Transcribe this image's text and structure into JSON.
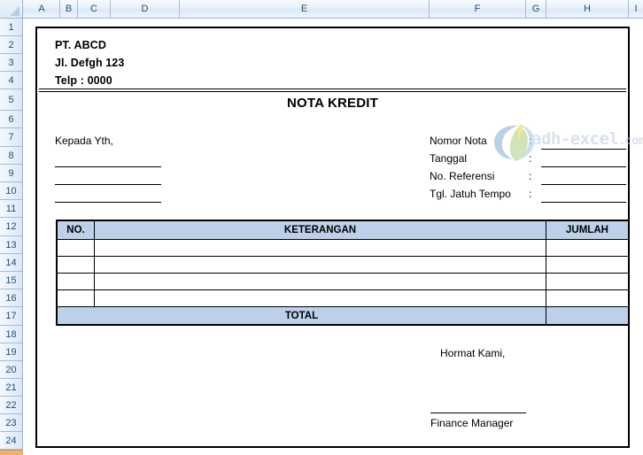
{
  "spreadsheet": {
    "column_headers": [
      "A",
      "B",
      "C",
      "D",
      "E",
      "F",
      "G",
      "H",
      "I"
    ],
    "row_headers": [
      "1",
      "2",
      "3",
      "4",
      "5",
      "6",
      "7",
      "8",
      "9",
      "10",
      "11",
      "12",
      "13",
      "14",
      "15",
      "16",
      "17",
      "18",
      "19",
      "20",
      "21",
      "22",
      "23",
      "24"
    ],
    "select_all_corner": "select-all-corner"
  },
  "document": {
    "company": {
      "name": "PT. ABCD",
      "address": "Jl. Defgh 123",
      "phone": "Telp : 0000"
    },
    "title": "NOTA KREDIT",
    "recipient": {
      "label": "Kepada Yth,",
      "lines": [
        "",
        "",
        ""
      ]
    },
    "meta_fields": [
      {
        "label": "Nomor Nota",
        "separator": ":",
        "value": ""
      },
      {
        "label": "Tanggal",
        "separator": ":",
        "value": ""
      },
      {
        "label": "No. Referensi",
        "separator": ":",
        "value": ""
      },
      {
        "label": "Tgl. Jatuh Tempo",
        "separator": ":",
        "value": ""
      }
    ],
    "table": {
      "headers": [
        "NO.",
        "KETERANGAN",
        "JUMLAH"
      ],
      "rows": [
        {
          "no": "",
          "keterangan": "",
          "jumlah": ""
        },
        {
          "no": "",
          "keterangan": "",
          "jumlah": ""
        },
        {
          "no": "",
          "keterangan": "",
          "jumlah": ""
        },
        {
          "no": "",
          "keterangan": "",
          "jumlah": ""
        }
      ],
      "total_label": "TOTAL",
      "total_value": "",
      "header_fill": "#bdd0ea",
      "total_fill": "#bdd0ea"
    },
    "signature": {
      "closing": "Hormat Kami,",
      "name_line": "",
      "position": "Finance Manager"
    }
  },
  "watermark": {
    "text": "adh-excel",
    "suffix": ".com",
    "color": "#c3cfe3"
  }
}
